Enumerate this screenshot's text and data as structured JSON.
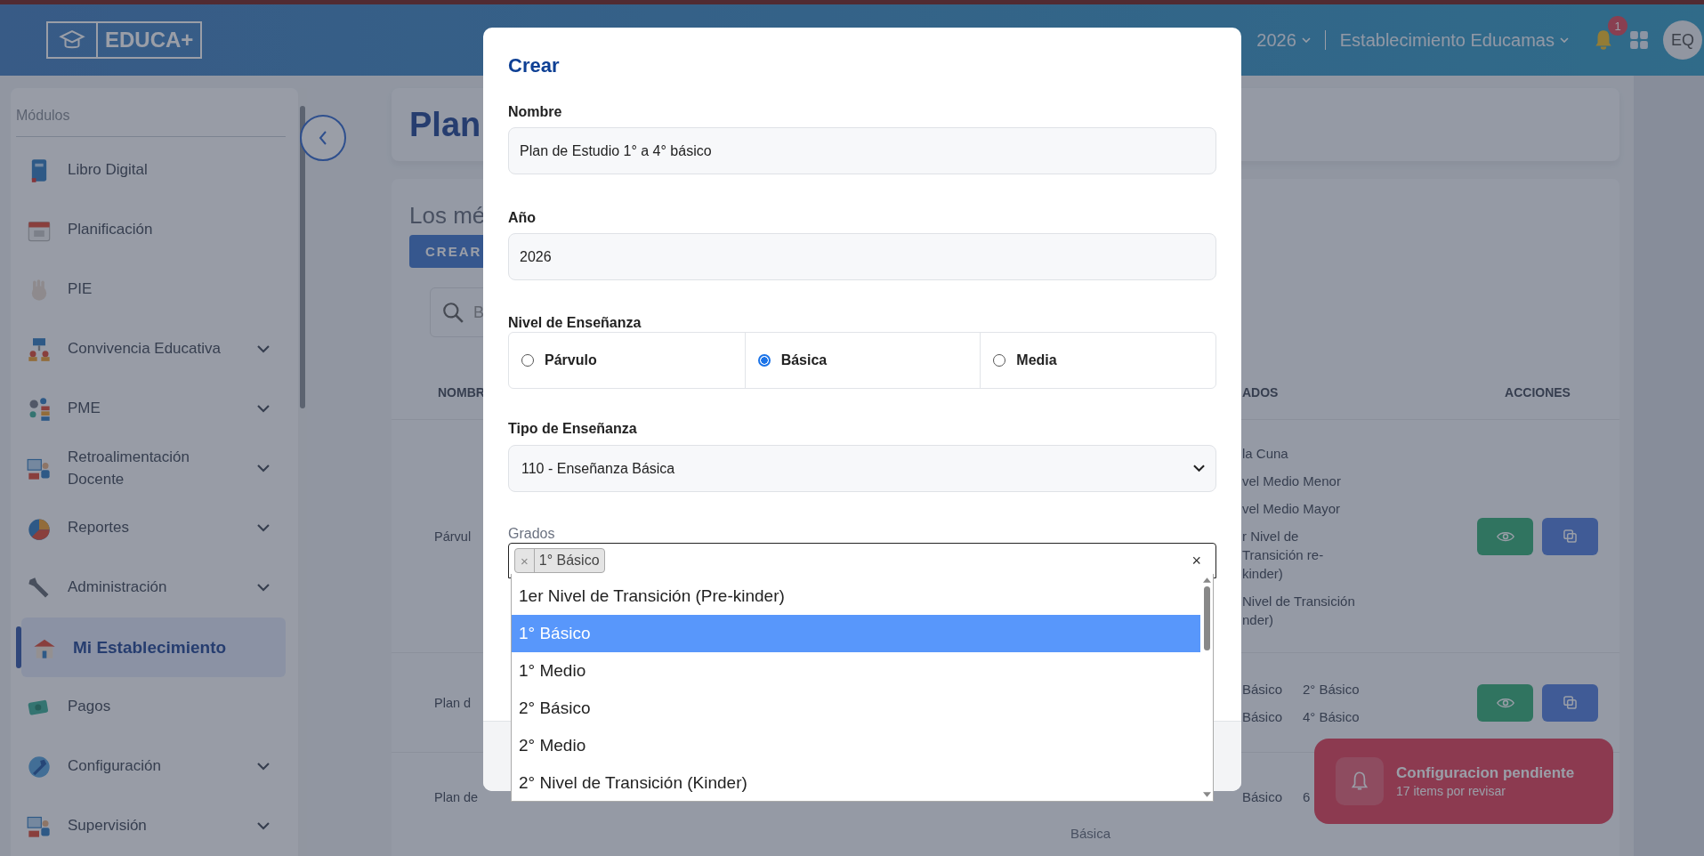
{
  "header": {
    "logo_text": "EDUCA+",
    "year": "2026",
    "school": "Establecimiento Educamas",
    "notifications": "1",
    "avatar": "EQ"
  },
  "sidebar": {
    "heading": "Módulos",
    "items": [
      {
        "label": "Libro Digital",
        "expandable": false,
        "selected": false
      },
      {
        "label": "Planificación",
        "expandable": false,
        "selected": false
      },
      {
        "label": "PIE",
        "expandable": false,
        "selected": false
      },
      {
        "label": "Convivencia Educativa",
        "expandable": true,
        "selected": false
      },
      {
        "label": "PME",
        "expandable": true,
        "selected": false
      },
      {
        "label": "Retroalimentación Docente",
        "expandable": true,
        "selected": false
      },
      {
        "label": "Reportes",
        "expandable": true,
        "selected": false
      },
      {
        "label": "Administración",
        "expandable": true,
        "selected": false
      },
      {
        "label": "Mi Establecimiento",
        "expandable": false,
        "selected": true
      },
      {
        "label": "Pagos",
        "expandable": false,
        "selected": false
      },
      {
        "label": "Configuración",
        "expandable": true,
        "selected": false
      },
      {
        "label": "Supervisión",
        "expandable": true,
        "selected": false
      }
    ]
  },
  "page": {
    "title": "Plan",
    "description": "Los mé",
    "create_button": "CREAR",
    "search_placeholder": "B",
    "table": {
      "column_1": "NOMBR",
      "column_3": "ADOS",
      "column_4": "ACCIONES",
      "rows": [
        {
          "name": "Párvul",
          "grades": [
            "la Cuna",
            "vel Medio Menor",
            "vel Medio Mayor",
            "r Nivel de Transición re-kinder)",
            "Nivel de Transición nder)"
          ],
          "actions": true
        },
        {
          "name": "Plan d",
          "grades": [
            "Básico",
            "2° Básico",
            "Básico",
            "4° Básico"
          ],
          "actions": true
        },
        {
          "name": "Plan de",
          "grades": [
            "Básico",
            "6"
          ],
          "middle": "Básica"
        }
      ]
    }
  },
  "toast": {
    "title": "Configuracion pendiente",
    "message": "17 items por revisar"
  },
  "modal": {
    "title": "Crear",
    "name_label": "Nombre",
    "name_value": "Plan de Estudio 1° a 4° básico",
    "year_label": "Año",
    "year_value": "2026",
    "level_label": "Nivel de Enseñanza",
    "level_options": [
      {
        "label": "Párvulo",
        "selected": false
      },
      {
        "label": "Básica",
        "selected": true
      },
      {
        "label": "Media",
        "selected": false
      }
    ],
    "type_label": "Tipo de Enseñanza",
    "type_value": "110 - Enseñanza Básica",
    "grades_label": "Grados",
    "grade_chips": [
      "1° Básico"
    ],
    "chip_remove": "×",
    "clear": "×",
    "grade_options": [
      {
        "label": "1er Nivel de Transición (Pre-kinder)",
        "selected": false
      },
      {
        "label": "1° Básico",
        "selected": true
      },
      {
        "label": "1° Medio",
        "selected": false
      },
      {
        "label": "2° Básico",
        "selected": false
      },
      {
        "label": "2° Medio",
        "selected": false
      },
      {
        "label": "2° Nivel de Transición (Kinder)",
        "selected": false
      }
    ]
  }
}
